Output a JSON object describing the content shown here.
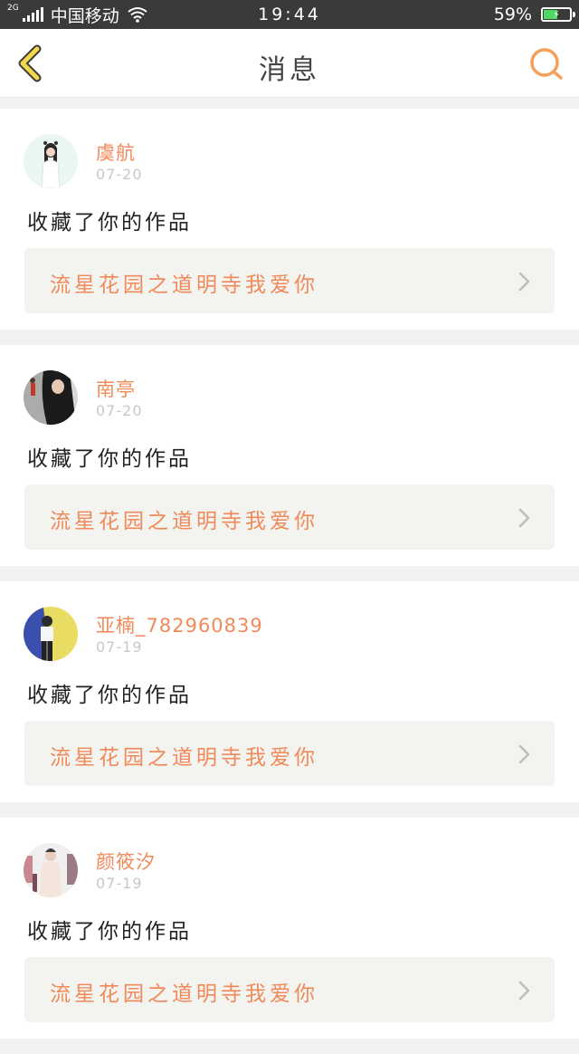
{
  "status_bar": {
    "network_type": "2G",
    "carrier": "中国移动",
    "time": "19:44",
    "battery_text": "59%",
    "battery_level": 0.59,
    "battery_fill_color": "#4cd964"
  },
  "header": {
    "title": "消息",
    "back_icon": "chevron-left-icon",
    "search_icon": "search-icon",
    "accent_color": "#f5a05a"
  },
  "messages": [
    {
      "username": "虞航",
      "date": "07-20",
      "action": "收藏了你的作品",
      "work_title": "流星花园之道明寺我爱你"
    },
    {
      "username": "南亭",
      "date": "07-20",
      "action": "收藏了你的作品",
      "work_title": "流星花园之道明寺我爱你"
    },
    {
      "username": "亚楠_782960839",
      "date": "07-19",
      "action": "收藏了你的作品",
      "work_title": "流星花园之道明寺我爱你"
    },
    {
      "username": "颜筱汐",
      "date": "07-19",
      "action": "收藏了你的作品",
      "work_title": "流星花园之道明寺我爱你"
    }
  ],
  "colors": {
    "username": "#f08a5a",
    "work_title": "#f08a5a",
    "date": "#c8c8c8",
    "link_background": "#f3f3ef"
  }
}
